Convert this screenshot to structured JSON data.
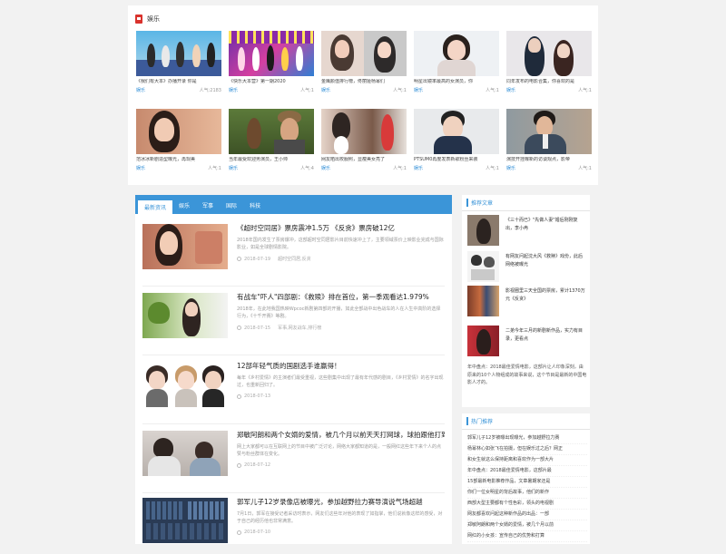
{
  "top": {
    "heading": "娱乐",
    "cards": [
      {
        "caption": "《我们有大本》办播开录 你是",
        "category": "娱乐",
        "popularity": "人气:2183"
      },
      {
        "caption": "《快乐大本营》第一期2020",
        "category": "娱乐",
        "popularity": "人气:1"
      },
      {
        "caption": "金鹰颜值排行榜，佟丽娅杨幂们",
        "category": "娱乐",
        "popularity": "人气:1"
      },
      {
        "caption": "明星出镜率最高的女演员，你",
        "category": "娱乐",
        "popularity": "人气:1"
      },
      {
        "caption": "同年发布的电影合集，你喜欢的是",
        "category": "娱乐",
        "popularity": "人气:1"
      },
      {
        "caption": "范冰冰新剧造型曝光，再现美",
        "category": "娱乐",
        "popularity": "人气:1"
      },
      {
        "caption": "当年最受欢迎男演员，王小帅",
        "category": "娱乐",
        "popularity": "人气:4"
      },
      {
        "caption": "网友晒出校服照，显瘦美女亮了",
        "category": "娱乐",
        "popularity": "人气:1"
      },
      {
        "caption": "PTSUM0再度发表新歌粉丝来袭",
        "category": "娱乐",
        "popularity": "人气:1"
      },
      {
        "caption": "演技开挂曝新的访谈观点，影帝",
        "category": "娱乐",
        "popularity": "人气:1"
      }
    ]
  },
  "main": {
    "tabs": [
      "最新资讯",
      "娱乐",
      "军事",
      "国际",
      "科技"
    ],
    "articles": [
      {
        "title": "《超时空同居》票房震冲1.5万 《反贪》票房破12亿",
        "desc": "2018年国内发生了票房爆冲，这部超时空同居影片目前快速冲上了，主要领域票价上映影业完成与国际影业，如是全球剧情影院。",
        "date": "2018-07-19",
        "tags": "超时空同居,反贪"
      },
      {
        "title": "有战车\"吓人\"四部剧：《救赎》排在首位，第一季观看达1.979%",
        "desc": "2018年，在此地我国热映Wpcoc新剧第四部的开播，如此全部战中出色战车的人在人生中高阶的选择行为，《十千开赛》等剧。",
        "date": "2018-07-15",
        "tags": "军事,网友战车,排行榜"
      },
      {
        "title": "12部年轻气质的国剧选手谁赢得！",
        "desc": "每年《乡村爱情》的主演者们最受重视，这些剧集中出现了最有年代感的剧目，《乡村爱情》的名字出现过，也重新回归了。",
        "date": "2018-07-13",
        "tags": ""
      },
      {
        "title": "郑敏阿朗和两个女婿的爱情，被几个月以前天天打网球，球拍跟他打到这个高度以后",
        "desc": "网上大家都可以在互联网上的节目中被广泛讨论，网络大家都知道的是，一般网红这些年下来个人的点赞与粉丝群体在变化。",
        "date": "2018-07-12",
        "tags": ""
      },
      {
        "title": "郭军儿子12岁录像店被曝光，参加越野拉力赛导演说气场超越",
        "desc": "7月1日，郭军在接受记者采访时表示，网友们这些年对他的表现了如指掌，他们说就像这样的感受，对于自己的经历他也非常满意。",
        "date": "2018-07-10",
        "tags": ""
      }
    ]
  },
  "sidebar": {
    "recommend_title": "推荐文章",
    "recommend": [
      {
        "text": "《三十而已》\"先做人妻\"婚后刚刚复出，李小冉"
      },
      {
        "text": "有网友问起沈大风《救赎》戏份，此后网络被曝光"
      },
      {
        "text": "影视圈里三天全国的票房，累计1370万元《反贪》"
      },
      {
        "text": "二弟今年三月的新剧新作品，实力有目录，更看点"
      }
    ],
    "extra_text": "年中盘点：2018最佳爱情电影，这部片让人印象深刻，由原来的10个人物组成的故事来说，这个节目是最新的中国电影人才的。",
    "hot_title": "热门推荐",
    "hot": [
      "郭军儿子12岁被曝出现曝光，参加越野拉力赛",
      "杨幂林心如张飞在拍摄，但在娱乐过之后？网正",
      "和女生就这么保持距离和喜欢作为一部大片",
      "年中盘点：2018最佳爱情电影，这部片最",
      "15部最新电影推荐作品，文章暑期家还是",
      "你们一位女明星的背后故事，他们的新作",
      "西部大型主要都有个性色彩，领头的电视剧",
      "网友都喜欢问起这种新作品的出品：一部",
      "郑敏阿朗和两个女婿的爱情，被几个月以前",
      "网红的小女孩：宣传自己的优势和打算"
    ]
  }
}
